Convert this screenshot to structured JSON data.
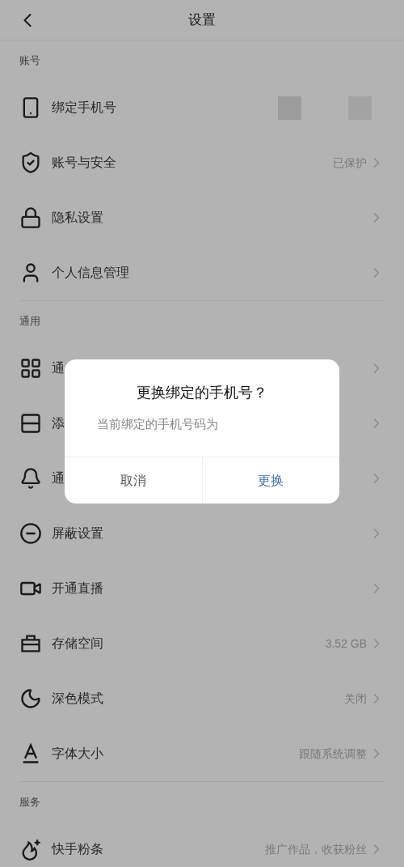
{
  "header": {
    "title": "设置"
  },
  "sections": [
    {
      "title": "账号",
      "rows": [
        {
          "kind": "masked",
          "label": "绑定手机号"
        },
        {
          "kind": "link",
          "label": "账号与安全",
          "value": "已保护"
        },
        {
          "kind": "link",
          "label": "隐私设置"
        },
        {
          "kind": "link",
          "label": "个人信息管理"
        }
      ]
    },
    {
      "title": "通用",
      "rows": [
        {
          "kind": "link",
          "label": "通"
        },
        {
          "kind": "link",
          "label": "添"
        },
        {
          "kind": "link",
          "label": "通"
        },
        {
          "kind": "link",
          "label": "屏蔽设置"
        },
        {
          "kind": "link",
          "label": "开通直播"
        },
        {
          "kind": "link",
          "label": "存储空间",
          "value": "3.52 GB"
        },
        {
          "kind": "link",
          "label": "深色模式",
          "value": "关闭"
        },
        {
          "kind": "link",
          "label": "字体大小",
          "value": "跟随系统调整"
        }
      ]
    },
    {
      "title": "服务",
      "rows": [
        {
          "kind": "link",
          "label": "快手粉条",
          "value": "推广作品，收获粉丝"
        }
      ]
    }
  ],
  "dialog": {
    "title": "更换绑定的手机号？",
    "message": "当前绑定的手机号码为",
    "buttons": [
      {
        "label": "取消",
        "kind": "cancel"
      },
      {
        "label": "更换",
        "kind": "confirm"
      }
    ]
  }
}
